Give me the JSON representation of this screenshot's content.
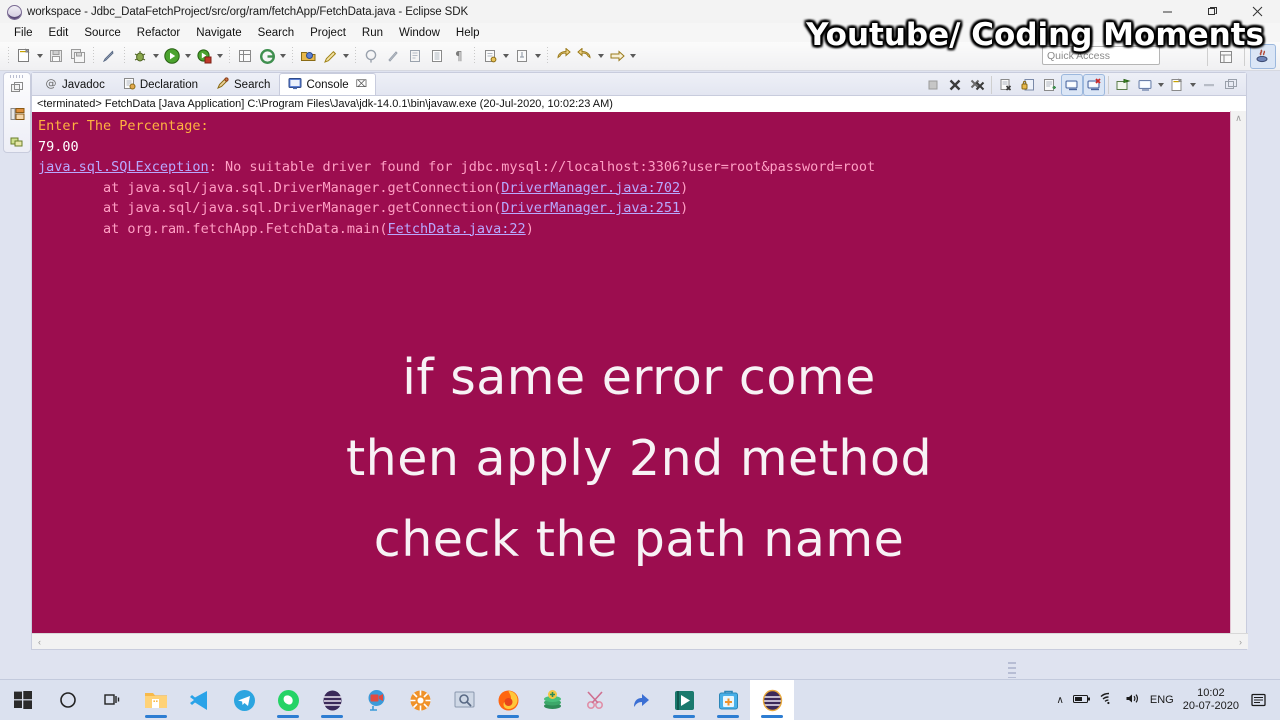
{
  "window": {
    "title": "workspace - Jdbc_DataFetchProject/src/org/ram/fetchApp/FetchData.java - Eclipse SDK",
    "app_icon": "eclipse-globe-icon",
    "controls": {
      "minimize": "minimize",
      "restore": "restore",
      "close": "close"
    }
  },
  "menubar": {
    "items": [
      "File",
      "Edit",
      "Source",
      "Refactor",
      "Navigate",
      "Search",
      "Project",
      "Run",
      "Window",
      "Help"
    ]
  },
  "toolbar": {
    "groups": [
      {
        "buttons": [
          {
            "name": "new-icon",
            "glyph": "new",
            "dropdown": true
          },
          {
            "name": "save-icon",
            "glyph": "save",
            "dropdown": false
          },
          {
            "name": "save-all-icon",
            "glyph": "saveall",
            "dropdown": false
          }
        ]
      },
      {
        "buttons": [
          {
            "name": "toggle-mark-occurrences-icon",
            "glyph": "pen",
            "dropdown": false
          }
        ]
      },
      {
        "buttons": [
          {
            "name": "debug-icon",
            "glyph": "bug",
            "dropdown": true
          },
          {
            "name": "run-icon",
            "glyph": "run",
            "dropdown": true
          },
          {
            "name": "run-external-tools-icon",
            "glyph": "tools",
            "dropdown": true
          }
        ]
      },
      {
        "buttons": [
          {
            "name": "new-java-package-icon",
            "glyph": "package",
            "dropdown": false
          },
          {
            "name": "new-java-class-icon",
            "glyph": "class",
            "dropdown": true
          }
        ]
      },
      {
        "buttons": [
          {
            "name": "open-type-icon",
            "glyph": "opentype",
            "dropdown": false
          },
          {
            "name": "search-icon",
            "glyph": "searchpen",
            "dropdown": true
          }
        ]
      },
      {
        "buttons": [
          {
            "name": "next-annotation-icon",
            "glyph": "nextanno",
            "dropdown": false
          },
          {
            "name": "previous-annotation-icon",
            "glyph": "prevanno",
            "dropdown": false
          },
          {
            "name": "last-edit-location-icon",
            "glyph": "lastedit",
            "dropdown": false
          },
          {
            "name": "toggle-block-selection-icon",
            "glyph": "block",
            "dropdown": false
          },
          {
            "name": "show-whitespace-icon",
            "glyph": "pilcrow",
            "dropdown": false
          }
        ]
      },
      {
        "buttons": [
          {
            "name": "open-task-icon",
            "glyph": "task",
            "dropdown": true
          },
          {
            "name": "pin-editor-icon",
            "glyph": "pin",
            "dropdown": true
          }
        ]
      },
      {
        "buttons": [
          {
            "name": "back-icon",
            "glyph": "back",
            "dropdown": false
          },
          {
            "name": "forward-icon",
            "glyph": "forward",
            "dropdown": true
          },
          {
            "name": "next-edit-icon",
            "glyph": "nextedit",
            "dropdown": true
          }
        ]
      }
    ],
    "quick_access_placeholder": "Quick Access",
    "perspectives": [
      {
        "name": "open-perspective-button",
        "label": "open-perspective-icon",
        "active": false
      },
      {
        "name": "perspective-java-button",
        "label": "java-perspective-icon",
        "active": true
      }
    ]
  },
  "left_stack": {
    "items": [
      {
        "name": "minimized-view-restore-icon"
      },
      {
        "name": "minimized-view-outline-icon"
      },
      {
        "name": "minimized-view-problems-icon"
      }
    ]
  },
  "view": {
    "tabs": [
      {
        "label": "Javadoc",
        "icon": "javadoc-icon",
        "active": false,
        "closable": false
      },
      {
        "label": "Declaration",
        "icon": "declaration-icon",
        "active": false,
        "closable": false
      },
      {
        "label": "Search",
        "icon": "search-view-icon",
        "active": false,
        "closable": false
      },
      {
        "label": "Console",
        "icon": "console-icon",
        "active": true,
        "closable": true
      }
    ],
    "tab_close_glyph": "⌧",
    "toolbar_icons": [
      {
        "name": "terminate-icon",
        "glyph": "stop",
        "active": false
      },
      {
        "name": "remove-launch-icon",
        "glyph": "x",
        "active": false
      },
      {
        "name": "remove-all-terminated-icon",
        "glyph": "xx",
        "active": false
      },
      {
        "name": "clear-console-icon",
        "glyph": "clear",
        "active": false
      },
      {
        "name": "lock-scroll-icon",
        "glyph": "lock",
        "active": false
      },
      {
        "name": "show-console-on-output-icon",
        "glyph": "showout",
        "active": false
      },
      {
        "name": "pin-console-icon",
        "glyph": "pinconsole",
        "active": true
      },
      {
        "name": "display-selected-console-icon",
        "glyph": "selcons",
        "active": true
      },
      {
        "name": "open-console-icon",
        "glyph": "opencons",
        "active": false
      },
      {
        "name": "display-console-dropdown-icon",
        "glyph": "displaycons",
        "active": false
      },
      {
        "name": "new-console-view-icon",
        "glyph": "newcons",
        "active": false
      },
      {
        "name": "minimize-view-icon",
        "glyph": "minimize",
        "active": false
      },
      {
        "name": "maximize-view-icon",
        "glyph": "maximize",
        "active": false
      }
    ]
  },
  "console": {
    "launch_header": "<terminated> FetchData [Java Application] C:\\Program Files\\Java\\jdk-14.0.1\\bin\\javaw.exe (20-Jul-2020, 10:02:23 AM)",
    "background_color": "#9c0d4f",
    "lines": [
      {
        "kind": "stdout",
        "color": "#ffb340",
        "text": "Enter The Percentage:"
      },
      {
        "kind": "stdout",
        "color": "#ffffff",
        "text": "79.00"
      },
      {
        "kind": "stderr",
        "color": "#ff9fc4",
        "segments": [
          {
            "text": "java.sql.SQLException",
            "link": true
          },
          {
            "text": ": No suitable driver found for jdbc.mysql://localhost:3306?user=root&password=root",
            "link": false
          }
        ]
      },
      {
        "kind": "stderr",
        "color": "#ff9fc4",
        "segments": [
          {
            "text": "\tat java.sql/java.sql.DriverManager.getConnection(",
            "link": false
          },
          {
            "text": "DriverManager.java:702",
            "link": true
          },
          {
            "text": ")",
            "link": false
          }
        ]
      },
      {
        "kind": "stderr",
        "color": "#ff9fc4",
        "segments": [
          {
            "text": "\tat java.sql/java.sql.DriverManager.getConnection(",
            "link": false
          },
          {
            "text": "DriverManager.java:251",
            "link": true
          },
          {
            "text": ")",
            "link": false
          }
        ]
      },
      {
        "kind": "stderr",
        "color": "#ff9fc4",
        "segments": [
          {
            "text": "\tat org.ram.fetchApp.FetchData.main(",
            "link": false
          },
          {
            "text": "FetchData.java:22",
            "link": true
          },
          {
            "text": ")",
            "link": false
          }
        ]
      }
    ],
    "scroll_up_glyph": "∧",
    "scroll_down_glyph": "∨",
    "scroll_left_glyph": "‹",
    "scroll_right_glyph": "›"
  },
  "overlay": {
    "lines": [
      "if same error come",
      "then apply 2nd method",
      "check the path name"
    ],
    "color": "#f7f2f5"
  },
  "watermark": {
    "text": "Youtube/ Coding Moments",
    "color": "#ffffff"
  },
  "taskbar": {
    "start": {
      "name": "start-button",
      "icon": "windows-logo-icon"
    },
    "items": [
      {
        "name": "cortana-icon",
        "glyph": "circle"
      },
      {
        "name": "task-view-icon",
        "glyph": "taskview"
      },
      {
        "name": "file-explorer-icon",
        "glyph": "folder",
        "running": true
      },
      {
        "name": "vs-code-icon",
        "glyph": "vscode",
        "running": false
      },
      {
        "name": "telegram-icon",
        "glyph": "telegram",
        "running": false
      },
      {
        "name": "whatsapp-icon",
        "glyph": "whatsapp",
        "running": true
      },
      {
        "name": "eclipse-icon",
        "glyph": "eclipse",
        "running": true
      },
      {
        "name": "camtasia-recorder-icon",
        "glyph": "recorder",
        "running": false
      },
      {
        "name": "media-player-icon",
        "glyph": "orangegear",
        "running": false
      },
      {
        "name": "screen-capture-icon",
        "glyph": "capture",
        "running": false
      },
      {
        "name": "firefox-icon",
        "glyph": "firefox",
        "running": true
      },
      {
        "name": "money-icon",
        "glyph": "money",
        "running": false
      },
      {
        "name": "snipping-tool-icon",
        "glyph": "scissors",
        "running": false
      },
      {
        "name": "cursor-arrow-icon",
        "glyph": "arrow",
        "running": false
      },
      {
        "name": "camtasia-studio-icon",
        "glyph": "camtasia",
        "running": true
      },
      {
        "name": "first-aid-icon",
        "glyph": "aid",
        "running": true
      },
      {
        "name": "eclipse-active-icon",
        "glyph": "eclipse",
        "running": true,
        "active": true
      }
    ],
    "tray": {
      "chevron": "∧",
      "battery": "battery-icon",
      "wifi": "wifi-icon",
      "volume": "volume-icon",
      "language": "ENG",
      "time": "10:02",
      "date": "20-07-2020",
      "action_center": "action-center-icon"
    }
  }
}
